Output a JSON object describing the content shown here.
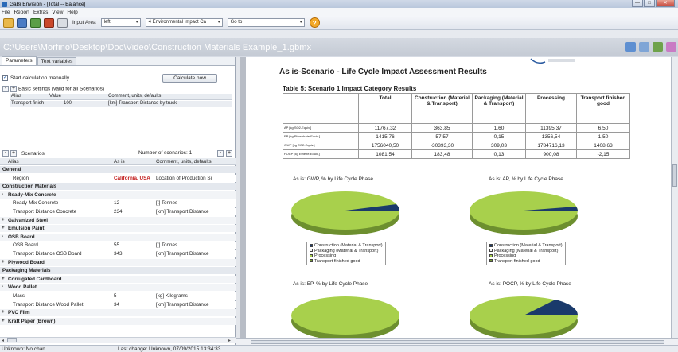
{
  "window": {
    "title": "GaBi Envision - [Total -- Balance]"
  },
  "menu": [
    "File",
    "Report",
    "Extras",
    "View",
    "Help"
  ],
  "toolbar": {
    "input_area_label": "Input Area",
    "input_area_value": "left",
    "categories_value": "4 Environmental Impact Ca",
    "goto_value": "Go to",
    "help_label": "?"
  },
  "path": "C:\\Users\\Morfino\\Desktop\\Doc\\Video\\Construction Materials Example_1.gbmx",
  "left": {
    "tabs": [
      "Parameters",
      "Text variables"
    ],
    "start_calc_label": "Start calculation manually",
    "calculate_label": "Calculate now",
    "basic_settings_label": "Basic settings (valid for all Scenarios)",
    "basic_headers": [
      "Alias",
      "Value",
      "Comment, units, defaults"
    ],
    "basic_row": {
      "alias": "Transport finish",
      "value": "100",
      "comment": "[km] Transport Distance by truck"
    },
    "scenarios_label": "Scenarios",
    "num_scenarios_label": "Number of scenarios: 1",
    "scen_headers": [
      "Alias",
      "As is",
      "Comment, units, defaults"
    ],
    "rows": [
      {
        "kind": "group",
        "sign": "-",
        "alias": "General",
        "val": "",
        "comment": ""
      },
      {
        "kind": "leaf",
        "sign": "",
        "alias": "Region",
        "val": "California, USA",
        "comment": "Location of Production Si",
        "red": true
      },
      {
        "kind": "group",
        "sign": "-",
        "alias": "Construction Materials",
        "val": "",
        "comment": ""
      },
      {
        "kind": "sub",
        "sign": "-",
        "alias": "Ready-Mix Concrete",
        "val": "",
        "comment": ""
      },
      {
        "kind": "leaf",
        "sign": "",
        "alias": "Ready-Mix Concrete",
        "val": "12",
        "comment": "[t] Tonnes"
      },
      {
        "kind": "leaf",
        "sign": "",
        "alias": "Transport Distance Concrete",
        "val": "234",
        "comment": "[km] Transport Distance"
      },
      {
        "kind": "sub",
        "sign": "+",
        "alias": "Galvanized Steel",
        "val": "",
        "comment": ""
      },
      {
        "kind": "sub",
        "sign": "+",
        "alias": "Emulsion Paint",
        "val": "",
        "comment": ""
      },
      {
        "kind": "sub",
        "sign": "-",
        "alias": "OSB Board",
        "val": "",
        "comment": ""
      },
      {
        "kind": "leaf",
        "sign": "",
        "alias": "OSB Board",
        "val": "55",
        "comment": "[t] Tonnes"
      },
      {
        "kind": "leaf",
        "sign": "",
        "alias": "Transport Distance OSB Board",
        "val": "343",
        "comment": "[km] Transport Distance"
      },
      {
        "kind": "sub",
        "sign": "+",
        "alias": "Plywood Board",
        "val": "",
        "comment": ""
      },
      {
        "kind": "group",
        "sign": "-",
        "alias": "Packaging Materials",
        "val": "",
        "comment": ""
      },
      {
        "kind": "sub",
        "sign": "+",
        "alias": "Corrugated Cardboard",
        "val": "",
        "comment": ""
      },
      {
        "kind": "sub",
        "sign": "-",
        "alias": "Wood Pallet",
        "val": "",
        "comment": ""
      },
      {
        "kind": "leaf",
        "sign": "",
        "alias": "Mass",
        "val": "5",
        "comment": "[kg] Kilograms"
      },
      {
        "kind": "leaf",
        "sign": "",
        "alias": "Transport Distance Wood Pallet",
        "val": "34",
        "comment": "[km] Transport Distance"
      },
      {
        "kind": "sub",
        "sign": "+",
        "alias": "PVC Film",
        "val": "",
        "comment": ""
      },
      {
        "kind": "sub",
        "sign": "+",
        "alias": "Kraft Paper (Brown)",
        "val": "",
        "comment": ""
      }
    ]
  },
  "doc": {
    "heading": "As is-Scenario - Life Cycle Impact Assessment Results",
    "table_caption": "Table 5: Scenario 1 Impact Category Results",
    "columns": [
      "",
      "Total",
      "Construction (Material & Transport)",
      "Packaging (Material & Transport)",
      "Processing",
      "Transport finished good"
    ],
    "rows": [
      [
        "AP [kg SO2-Equiv.]",
        "11767,32",
        "363,85",
        "1,60",
        "11395,37",
        "6,50"
      ],
      [
        "EP [kg Phosphate-Equiv.]",
        "1415,76",
        "57,57",
        "0,15",
        "1356,54",
        "1,50"
      ],
      [
        "GWP [kg CO2-Equiv.]",
        "1756040,50",
        "-30393,30",
        "309,03",
        "1784716,13",
        "1408,63"
      ],
      [
        "POCP [kg Ethene-Equiv.]",
        "1081,54",
        "183,48",
        "0,13",
        "900,08",
        "-2,15"
      ]
    ],
    "legend": [
      "Construction (Material & Transport)",
      "Packaging (Material & Transport)",
      "Processing",
      "Transport finished good"
    ],
    "pie_titles": [
      "As is: GWP, % by Life Cycle Phase",
      "As is: AP, % by Life Cycle Phase",
      "As is: EP, % by Life Cycle Phase",
      "As is: POCP, % by Life Cycle Phase"
    ],
    "colors": {
      "construction": "#1a3a6b",
      "packaging": "#f2f2f2",
      "processing": "#a7d14a",
      "transport": "#7a9b3a"
    }
  },
  "status": {
    "left": "Unknown: No chan",
    "right": "Last change: Unknown, 07/09/2015 13:34:33"
  }
}
